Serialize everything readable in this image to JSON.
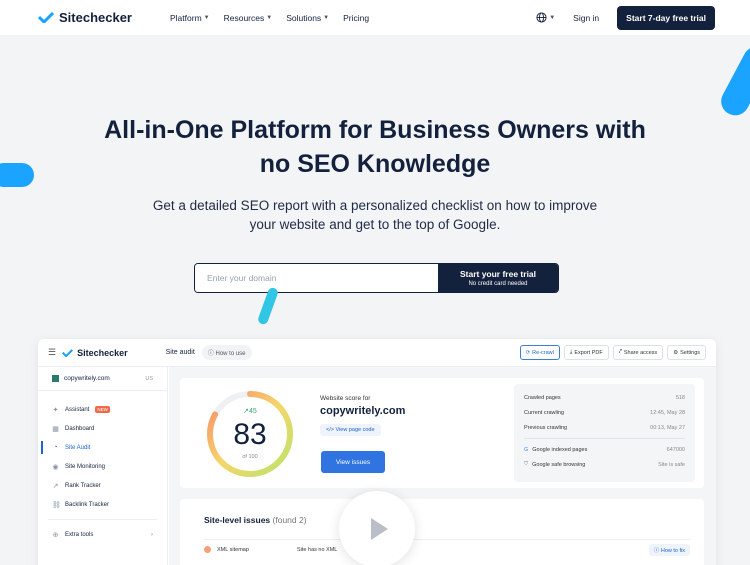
{
  "nav": {
    "brand": "Sitechecker",
    "menu": [
      "Platform",
      "Resources",
      "Solutions",
      "Pricing"
    ],
    "sign_in": "Sign in",
    "trial_button": "Start 7-day free trial"
  },
  "hero": {
    "title_line1": "All-in-One Platform for Business Owners with",
    "title_line2": "no SEO Knowledge",
    "subtitle_line1": "Get a detailed SEO report with a personalized checklist on how to improve",
    "subtitle_line2": "your website and get to the top of Google.",
    "domain_placeholder": "Enter your domain",
    "cta_label": "Start your free trial",
    "cta_note": "No credit card needed"
  },
  "app": {
    "brand": "Sitechecker",
    "crumb": "Site audit",
    "how_to_use": "How to use",
    "actions": [
      "Re-crawl",
      "Export PDF",
      "Share access",
      "Settings"
    ],
    "project": "copywritely.com",
    "region": "US",
    "sidebar": [
      {
        "label": "Assistant",
        "icon": "wand-icon",
        "badge": "NEW"
      },
      {
        "label": "Dashboard",
        "icon": "dashboard-icon"
      },
      {
        "label": "Site Audit",
        "icon": "audit-icon",
        "active": true
      },
      {
        "label": "Site Monitoring",
        "icon": "monitoring-icon"
      },
      {
        "label": "Rank Tracker",
        "icon": "rank-icon"
      },
      {
        "label": "Backlink Tracker",
        "icon": "link-icon"
      }
    ],
    "extra_tools": "Extra tools",
    "score": {
      "value": "83",
      "of": "of 100",
      "delta": "45",
      "label": "Website score for",
      "domain": "copywritely.com",
      "view_code": "View page code",
      "view_issues": "View issues"
    },
    "stats": [
      {
        "label": "Crawled pages",
        "value": "518"
      },
      {
        "label": "Current crawling",
        "value": "12:45, May 28"
      },
      {
        "label": "Previous crawling",
        "value": "00:13, May 27"
      },
      {
        "label": "Google indexed pages",
        "value": "647000"
      },
      {
        "label": "Google safe browsing",
        "value": "Site is safe"
      }
    ],
    "issues_title": "Site-level issues",
    "issues_count": "(found 2)",
    "issue": {
      "name": "XML sitemap",
      "desc": "Site has no XML",
      "fix": "How to fix"
    }
  },
  "colors": {
    "brand": "#14213d",
    "accent": "#1aa3ff",
    "button_blue": "#2f74e0"
  }
}
